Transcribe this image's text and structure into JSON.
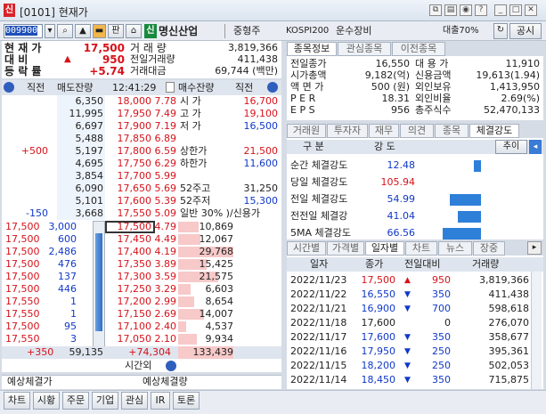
{
  "window": {
    "logo": "신",
    "title": "[0101] 현재가"
  },
  "toolbar": {
    "code": "009900",
    "search_icon": "search-icon",
    "pan_label": "판",
    "sin_badge": "신",
    "stock_name": "명신산업",
    "sector": "중형주",
    "index": "KOSPI200",
    "industry": "운수장비",
    "loan": "대출70%",
    "share_label": "공시"
  },
  "quote": {
    "rows": [
      {
        "label": "현 재 가",
        "value": "17,500",
        "label2": "거 래 량",
        "value2": "3,819,366"
      },
      {
        "label": "대 비",
        "arrow": "▲",
        "value": "950",
        "label2": "전일거래량",
        "value2": "411,438"
      },
      {
        "label": "등 락 률",
        "value": "+5.74",
        "label2": "거래대금",
        "value2": "69,744 (백만)"
      }
    ]
  },
  "orderbook": {
    "head": {
      "c1": "직전",
      "c2": "매도잔량",
      "time": "12:41:29",
      "c4": "매수잔량",
      "c5": "직전"
    },
    "asks": [
      {
        "qty": "6,350",
        "price": "18,000",
        "pct": "7.78",
        "lbl": "시 가",
        "val": "16,700"
      },
      {
        "qty": "11,995",
        "price": "17,950",
        "pct": "7.49",
        "lbl": "고 가",
        "val": "19,100"
      },
      {
        "qty": "6,697",
        "price": "17,900",
        "pct": "7.19",
        "lbl": "저 가",
        "val": "16,500"
      },
      {
        "qty": "5,488",
        "price": "17,850",
        "pct": "6.89",
        "lbl": "",
        "val": ""
      },
      {
        "prev": "+500",
        "qty": "5,197",
        "price": "17,800",
        "pct": "6.59",
        "lbl": "상한가",
        "val": "21,500"
      },
      {
        "qty": "4,695",
        "price": "17,750",
        "pct": "6.29",
        "lbl": "하한가",
        "val": "11,600"
      },
      {
        "qty": "3,854",
        "price": "17,700",
        "pct": "5.99",
        "lbl": "",
        "val": ""
      },
      {
        "qty": "6,090",
        "price": "17,650",
        "pct": "5.69",
        "lbl": "52주고",
        "val": "31,250"
      },
      {
        "qty": "5,101",
        "price": "17,600",
        "pct": "5.39",
        "lbl": "52주저",
        "val": "15,300"
      },
      {
        "prev": "-150",
        "qty": "3,668",
        "price": "17,550",
        "pct": "5.09",
        "lbl": "일반 30% )/신용가",
        "val": ""
      }
    ],
    "bids": [
      {
        "p": "17,500",
        "q": "3,000",
        "price": "17,500",
        "pct": "4.79",
        "qty": "10,869"
      },
      {
        "p": "17,500",
        "q": "600",
        "price": "17,450",
        "pct": "4.49",
        "qty": "12,067"
      },
      {
        "p": "17,500",
        "q": "2,486",
        "price": "17,400",
        "pct": "4.19",
        "qty": "29,768"
      },
      {
        "p": "17,500",
        "q": "476",
        "price": "17,350",
        "pct": "3.89",
        "qty": "15,425"
      },
      {
        "p": "17,500",
        "q": "137",
        "price": "17,300",
        "pct": "3.59",
        "qty": "21,575"
      },
      {
        "p": "17,500",
        "q": "446",
        "price": "17,250",
        "pct": "3.29",
        "qty": "6,603"
      },
      {
        "p": "17,550",
        "q": "1",
        "price": "17,200",
        "pct": "2.99",
        "qty": "8,654"
      },
      {
        "p": "17,550",
        "q": "1",
        "price": "17,150",
        "pct": "2.69",
        "qty": "14,007"
      },
      {
        "p": "17,500",
        "q": "95",
        "price": "17,100",
        "pct": "2.40",
        "qty": "4,537"
      },
      {
        "p": "17,550",
        "q": "3",
        "price": "17,050",
        "pct": "2.10",
        "qty": "9,934"
      }
    ],
    "totals": {
      "prev": "+350",
      "ask": "59,135",
      "bidchg": "+74,304",
      "bid": "133,439"
    },
    "after": "시간외",
    "exp1": "예상체결가",
    "exp2": "예상체결량"
  },
  "info_tabs": [
    "종목정보",
    "관심종목",
    "이전종목"
  ],
  "info": {
    "left": [
      {
        "l": "전일종가",
        "v": "16,550"
      },
      {
        "l": "시가총액",
        "v": "9,182(억)"
      },
      {
        "l": "액 면 가",
        "v": "500 (원)"
      },
      {
        "l": "P E R",
        "v": "18.31"
      },
      {
        "l": "E P S",
        "v": "956"
      }
    ],
    "right": [
      {
        "l": "대 용 가",
        "v": "11,910"
      },
      {
        "l": "신용금액",
        "v": "19,613(1.94)"
      },
      {
        "l": "외인보유",
        "v": "1,413,950"
      },
      {
        "l": "외인비율",
        "v": "2.69(%)"
      },
      {
        "l": "총주식수",
        "v": "52,470,133"
      }
    ]
  },
  "str_tabs": [
    "거래원",
    "투자자",
    "재무",
    "의견",
    "종목",
    "체결강도"
  ],
  "strength": {
    "h1": "구 분",
    "h2": "강 도",
    "btn": "추이",
    "rows": [
      {
        "l": "순간 체결강도",
        "v": "12.48",
        "w": 0.12
      },
      {
        "l": "당일 체결강도",
        "v": "105.94",
        "w": 0.0
      },
      {
        "l": "전일 체결강도",
        "v": "54.99",
        "w": 0.55
      },
      {
        "l": "전전일 체결강",
        "v": "41.04",
        "w": 0.41
      },
      {
        "l": "5MA 체결강도",
        "v": "66.56",
        "w": 0.67
      }
    ]
  },
  "daily_tabs": [
    "시간별",
    "가격별",
    "일자별",
    "차트",
    "뉴스",
    "장중"
  ],
  "daily": {
    "head": [
      "일자",
      "종가",
      "전일대비",
      "거래량"
    ],
    "rows": [
      {
        "d": "2022/11/23",
        "c": "17,500",
        "s": "▲",
        "ch": "950",
        "v": "3,819,366"
      },
      {
        "d": "2022/11/22",
        "c": "16,550",
        "s": "▼",
        "ch": "350",
        "v": "411,438"
      },
      {
        "d": "2022/11/21",
        "c": "16,900",
        "s": "▼",
        "ch": "700",
        "v": "598,618"
      },
      {
        "d": "2022/11/18",
        "c": "17,600",
        "s": "",
        "ch": "0",
        "v": "276,070"
      },
      {
        "d": "2022/11/17",
        "c": "17,600",
        "s": "▼",
        "ch": "350",
        "v": "358,677"
      },
      {
        "d": "2022/11/16",
        "c": "17,950",
        "s": "▼",
        "ch": "250",
        "v": "395,361"
      },
      {
        "d": "2022/11/15",
        "c": "18,200",
        "s": "▼",
        "ch": "250",
        "v": "502,053"
      },
      {
        "d": "2022/11/14",
        "c": "18,450",
        "s": "▼",
        "ch": "350",
        "v": "715,875"
      }
    ]
  },
  "bottom": [
    "차트",
    "시황",
    "주문",
    "기업",
    "관심",
    "IR",
    "토론"
  ]
}
